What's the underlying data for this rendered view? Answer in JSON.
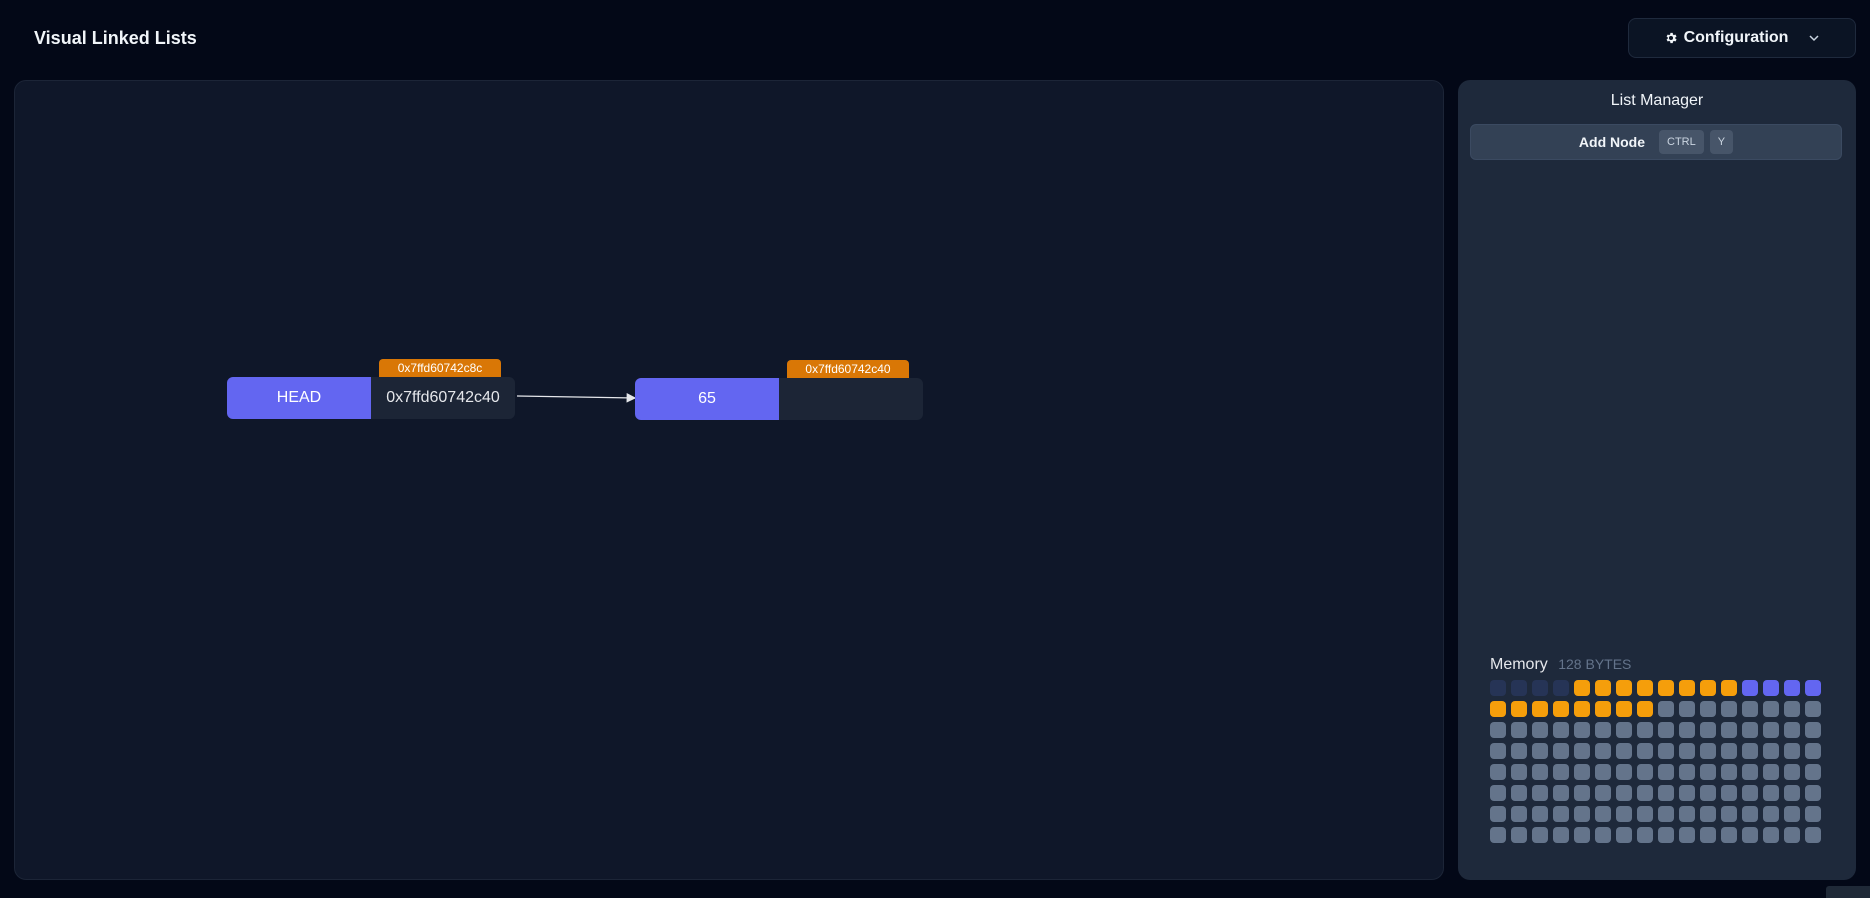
{
  "app": {
    "title": "Visual Linked Lists"
  },
  "header": {
    "config_label": "Configuration",
    "config_icon": "gear-icon",
    "dropdown_icon": "chevron-down-icon"
  },
  "canvas": {
    "nodes": [
      {
        "value": "HEAD",
        "pointer": "0x7ffd60742c40",
        "address": "0x7ffd60742c8c"
      },
      {
        "value": "65",
        "pointer": "",
        "address": "0x7ffd60742c40"
      }
    ]
  },
  "panel": {
    "title": "List Manager",
    "add_node_label": "Add Node",
    "shortcut_keys": [
      "CTRL",
      "Y"
    ]
  },
  "memory": {
    "label": "Memory",
    "size_label": "128 BYTES",
    "cells": [
      "reserved",
      "reserved",
      "reserved",
      "reserved",
      "pointer",
      "pointer",
      "pointer",
      "pointer",
      "pointer",
      "pointer",
      "pointer",
      "pointer",
      "value",
      "value",
      "value",
      "value",
      "pointer",
      "pointer",
      "pointer",
      "pointer",
      "pointer",
      "pointer",
      "pointer",
      "pointer",
      "free",
      "free",
      "free",
      "free",
      "free",
      "free",
      "free",
      "free",
      "free",
      "free",
      "free",
      "free",
      "free",
      "free",
      "free",
      "free",
      "free",
      "free",
      "free",
      "free",
      "free",
      "free",
      "free",
      "free",
      "free",
      "free",
      "free",
      "free",
      "free",
      "free",
      "free",
      "free",
      "free",
      "free",
      "free",
      "free",
      "free",
      "free",
      "free",
      "free",
      "free",
      "free",
      "free",
      "free",
      "free",
      "free",
      "free",
      "free",
      "free",
      "free",
      "free",
      "free",
      "free",
      "free",
      "free",
      "free",
      "free",
      "free",
      "free",
      "free",
      "free",
      "free",
      "free",
      "free",
      "free",
      "free",
      "free",
      "free",
      "free",
      "free",
      "free",
      "free",
      "free",
      "free",
      "free",
      "free",
      "free",
      "free",
      "free",
      "free",
      "free",
      "free",
      "free",
      "free",
      "free",
      "free",
      "free",
      "free",
      "free",
      "free",
      "free",
      "free",
      "free",
      "free",
      "free",
      "free",
      "free",
      "free",
      "free",
      "free",
      "free",
      "free",
      "free",
      "free"
    ]
  },
  "colors": {
    "background": "#030817",
    "canvas": "#0f1729",
    "panel": "#1e293b",
    "node_value": "#6366f1",
    "address_tag": "#d97706",
    "memory_pointer": "#f59e0b",
    "memory_value": "#6366f1",
    "memory_reserved": "#263456",
    "memory_free": "#64748b"
  }
}
